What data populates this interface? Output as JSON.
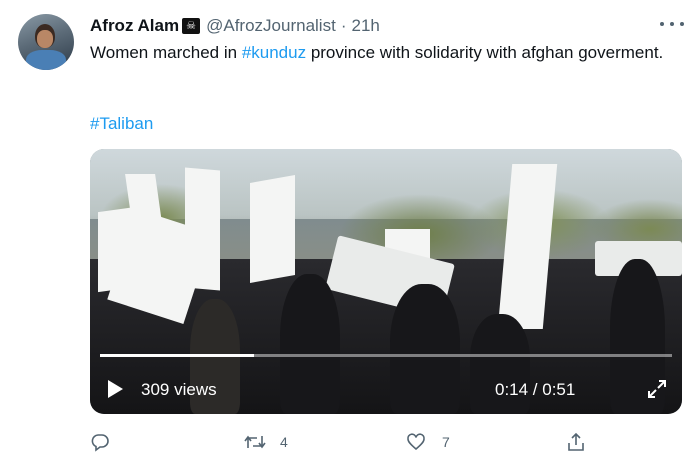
{
  "tweet": {
    "display_name": "Afroz Alam",
    "name_emoji": "☠",
    "handle": "@AfrozJournalist",
    "separator": "·",
    "time": "21h",
    "text_before": "Women marched in ",
    "text_hashtag": "#kunduz",
    "text_after": " province with solidarity with afghan goverment.",
    "hashtag_line": "#Taliban"
  },
  "video": {
    "views": "309 views",
    "time": "0:14 / 0:51",
    "progress": 0.27
  },
  "actions": {
    "reply_count": "",
    "retweet_count": "4",
    "like_count": "7"
  },
  "colors": {
    "accent": "#1d9bf0",
    "secondary_text": "#536471"
  },
  "icons": [
    "more-icon",
    "reply-icon",
    "retweet-icon",
    "like-icon",
    "share-icon",
    "play-icon",
    "expand-icon"
  ]
}
